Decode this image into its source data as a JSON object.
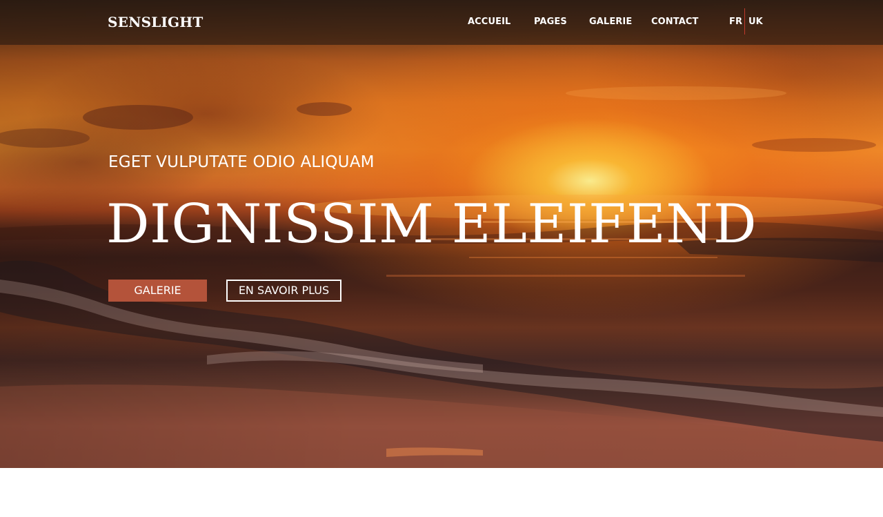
{
  "header": {
    "brand": "SENSLIGHT",
    "nav": [
      {
        "label": "ACCUEIL"
      },
      {
        "label": "PAGES"
      },
      {
        "label": "GALERIE"
      },
      {
        "label": "CONTACT"
      }
    ],
    "languages": [
      {
        "label": "FR"
      },
      {
        "label": "UK"
      }
    ]
  },
  "hero": {
    "kicker": "EGET VULPUTATE ODIO ALIQUAM",
    "headline": "DIGNISSIM ELEIFEND",
    "buttons": {
      "primary": "GALERIE",
      "secondary": "EN SAVOIR PLUS"
    }
  },
  "colors": {
    "accent": "#b4533a",
    "lang_separator": "#c0392b",
    "header_overlay": "#281a12"
  }
}
